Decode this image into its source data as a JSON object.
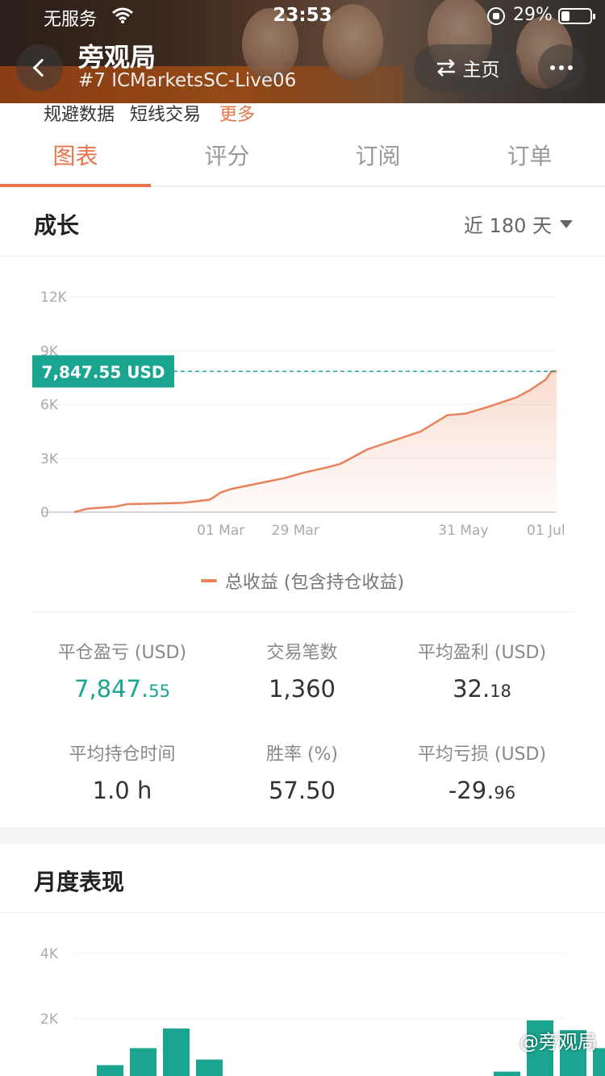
{
  "status_bar": {
    "carrier": "无服务",
    "time": "23:53",
    "battery": "29%"
  },
  "header": {
    "title": "旁观局",
    "subtitle": "#7 ICMarketsSC-Live06",
    "home_label": "主页"
  },
  "tags": [
    "规避数据",
    "短线交易"
  ],
  "tags_more": "更多",
  "tabs": [
    {
      "label": "图表",
      "active": true
    },
    {
      "label": "评分",
      "active": false
    },
    {
      "label": "订阅",
      "active": false
    },
    {
      "label": "订单",
      "active": false
    }
  ],
  "growth": {
    "title": "成长",
    "range": "近 180 天"
  },
  "chart_data": {
    "type": "area",
    "ylim": [
      0,
      12000
    ],
    "y_ticks": [
      "0",
      "3K",
      "6K",
      "9K",
      "12K"
    ],
    "x_ticks": [
      "01 Mar",
      "29 Mar",
      "31 May",
      "01 Jul"
    ],
    "current_label": "7,847.55 USD",
    "current_value": 7847.55,
    "series": [
      {
        "name": "总收益 (包含持仓收益)",
        "x": [
          "2021-01-05",
          "2021-01-10",
          "2021-01-20",
          "2021-01-25",
          "2021-02-05",
          "2021-02-15",
          "2021-02-25",
          "2021-03-01",
          "2021-03-05",
          "2021-03-15",
          "2021-03-25",
          "2021-04-01",
          "2021-04-10",
          "2021-04-15",
          "2021-04-25",
          "2021-05-05",
          "2021-05-15",
          "2021-05-25",
          "2021-06-01",
          "2021-06-10",
          "2021-06-20",
          "2021-06-25",
          "2021-06-28",
          "2021-07-01",
          "2021-07-03",
          "2021-07-05"
        ],
        "y": [
          0,
          200,
          300,
          450,
          480,
          520,
          700,
          1100,
          1300,
          1600,
          1900,
          2200,
          2500,
          2700,
          3500,
          4000,
          4500,
          5400,
          5500,
          5900,
          6400,
          6800,
          7100,
          7400,
          7847,
          7847
        ]
      }
    ],
    "series_color": "#e8825a",
    "label_color": "#19a58f"
  },
  "stats": [
    {
      "label": "平仓盈亏 (USD)",
      "int": "7,847.",
      "dec": "55",
      "green": true
    },
    {
      "label": "交易笔数",
      "int": "1,360",
      "dec": "",
      "green": false
    },
    {
      "label": "平均盈利 (USD)",
      "int": "32.",
      "dec": "18",
      "green": false
    },
    {
      "label": "平均持仓时间",
      "int": "1.0 h",
      "dec": "",
      "green": false
    },
    {
      "label": "胜率 (%)",
      "int": "57.50",
      "dec": "",
      "green": false
    },
    {
      "label": "平均亏损 (USD)",
      "int": "-29.",
      "dec": "96",
      "green": false
    }
  ],
  "monthly": {
    "title": "月度表现",
    "chart_data": {
      "type": "bar",
      "ylim": [
        0,
        4000
      ],
      "y_ticks": [
        "2K",
        "4K"
      ],
      "values": [
        580,
        1100,
        1700,
        750,
        0,
        0,
        0,
        0,
        0,
        0,
        0,
        200,
        380,
        1950,
        1650,
        1100,
        2550
      ],
      "color": "#19a58f"
    }
  },
  "watermark": "@旁观局"
}
